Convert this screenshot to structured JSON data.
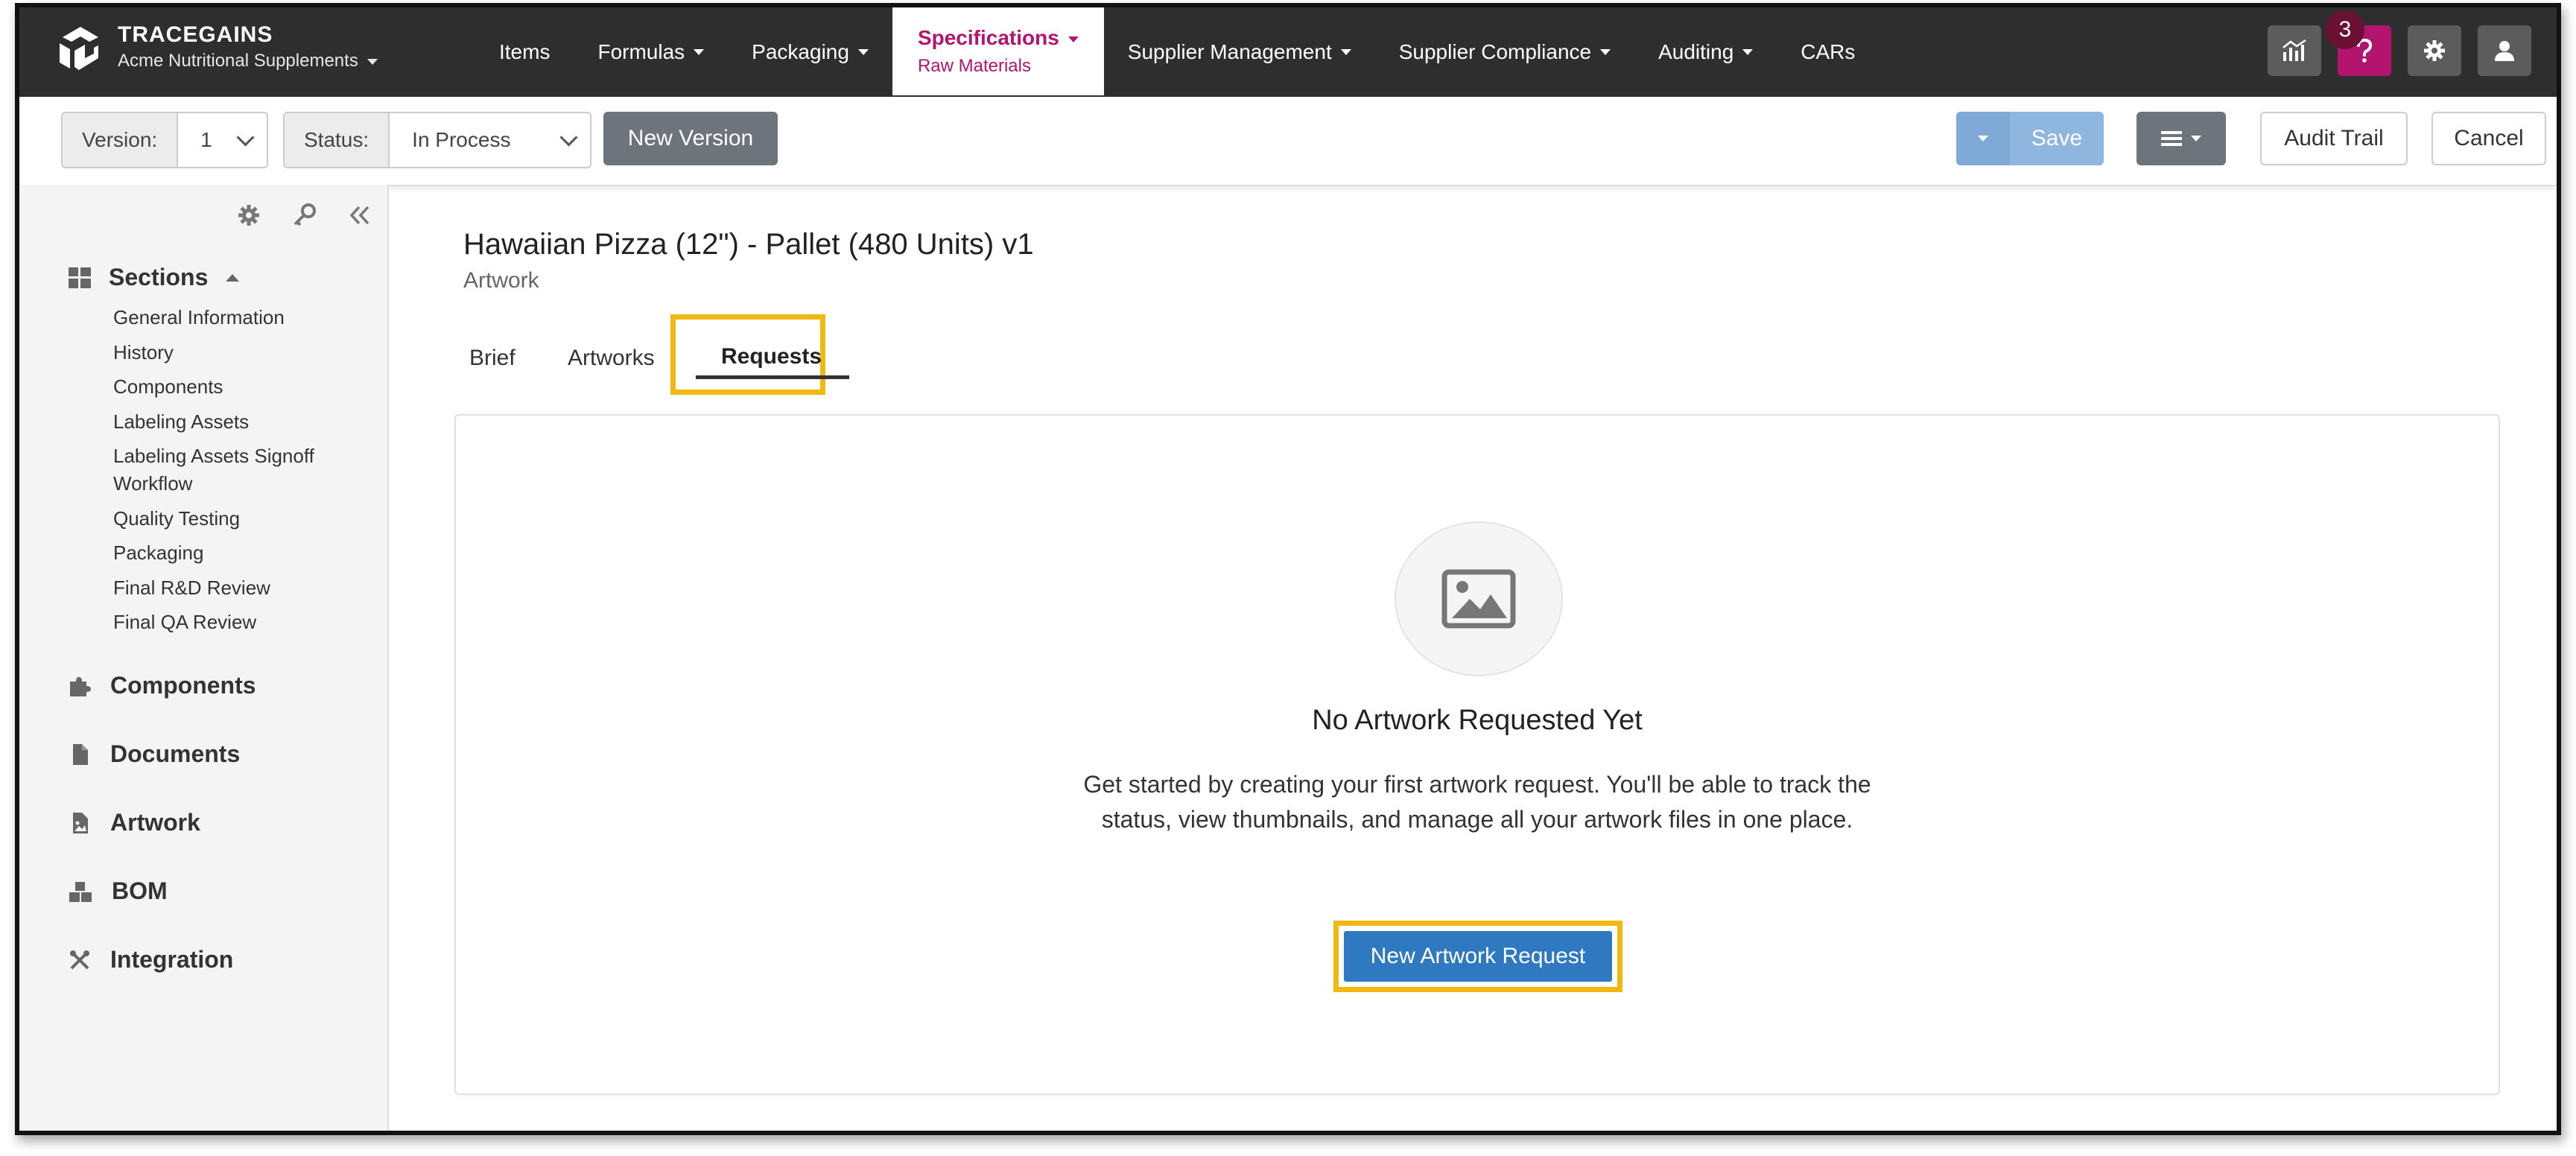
{
  "brand": {
    "name": "TRACEGAINS",
    "company": "Acme Nutritional Supplements"
  },
  "nav": {
    "items": [
      "Items",
      "Formulas",
      "Packaging",
      "Specifications",
      "Supplier Management",
      "Supplier Compliance",
      "Auditing",
      "CARs"
    ],
    "active": {
      "label": "Specifications",
      "sub": "Raw Materials"
    },
    "help_badge": "3"
  },
  "toolbar": {
    "version_label": "Version:",
    "version_value": "1",
    "status_label": "Status:",
    "status_value": "In Process",
    "new_version": "New Version",
    "save": "Save",
    "audit_trail": "Audit Trail",
    "cancel": "Cancel"
  },
  "sidebar": {
    "sections_header": "Sections",
    "sections": [
      "General Information",
      "History",
      "Components",
      "Labeling Assets",
      "Labeling Assets Signoff Workflow",
      "Quality Testing",
      "Packaging",
      "Final R&D Review",
      "Final QA Review"
    ],
    "main": [
      "Components",
      "Documents",
      "Artwork",
      "BOM",
      "Integration"
    ]
  },
  "page": {
    "title": "Hawaiian Pizza (12\") - Pallet (480 Units) v1",
    "subtitle": "Artwork",
    "tabs": [
      "Brief",
      "Artworks",
      "Requests"
    ]
  },
  "empty": {
    "title": "No Artwork Requested Yet",
    "description": "Get started by creating your first artwork request. You'll be able to track the status, view thumbnails, and manage all your artwork files in one place.",
    "cta": "New Artwork Request"
  },
  "colors": {
    "navbar": "#2e2e2e",
    "accent": "#b3156e",
    "primary": "#2f79c0",
    "highlight": "#f2b80f"
  }
}
